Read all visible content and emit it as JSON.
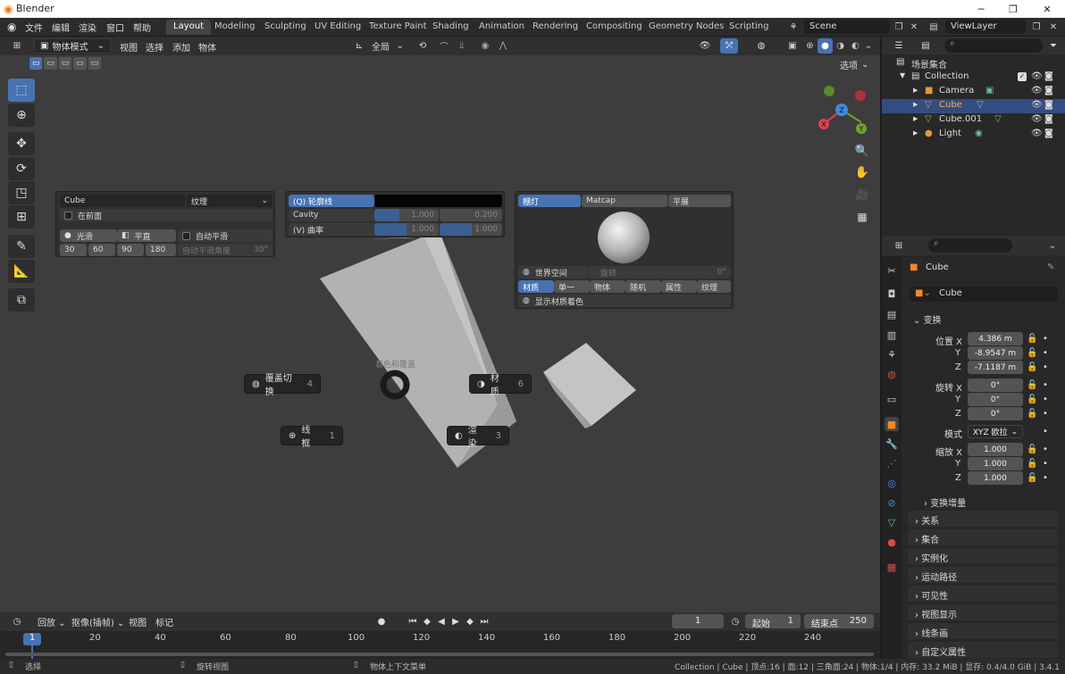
{
  "window": {
    "title": "Blender",
    "min_icon": "minimize-icon",
    "max_icon": "maximize-icon",
    "close_icon": "close-icon"
  },
  "menu": {
    "items": [
      "文件",
      "编辑",
      "渲染",
      "窗口",
      "帮助"
    ]
  },
  "workspaces": {
    "tabs": [
      "Layout",
      "Modeling",
      "Sculpting",
      "UV Editing",
      "Texture Paint",
      "Shading",
      "Animation",
      "Rendering",
      "Compositing",
      "Geometry Nodes",
      "Scripting"
    ],
    "active": "Layout"
  },
  "scene": {
    "label": "Scene",
    "view_layer": "ViewLayer"
  },
  "viewport": {
    "mode": "物体模式",
    "menus": [
      "视图",
      "选择",
      "添加",
      "物体"
    ],
    "transform_orientation": "全局",
    "options_label": "选项",
    "gizmo_axes": {
      "x": "X",
      "y": "Y",
      "z": "Z"
    }
  },
  "overlay_panel": {
    "object_name": "Cube",
    "texture_label": "纹理",
    "in_front": "在前面",
    "smooth": "光滑",
    "flat": "平直",
    "auto_smooth": "自动平滑",
    "angles": [
      "30",
      "60",
      "90",
      "180"
    ],
    "auto_smooth_angle_label": "自动平滑角度",
    "auto_smooth_angle_value": "30°"
  },
  "cavity_panel": {
    "outline_label": "(Q) 轮廓线",
    "cavity_label": "Cavity",
    "cavity_v1": "1.000",
    "cavity_v2": "0.200",
    "curvature_label": "(V) 曲率",
    "curv_v1": "1.000",
    "curv_v2": "1.000"
  },
  "lighting_panel": {
    "tabs": [
      "棚灯",
      "Matcap",
      "平展"
    ],
    "active_tab": "棚灯",
    "world_space": "世界空间",
    "rotation_label": "旋转",
    "rotation_value": "0°",
    "color_tabs": [
      "材质",
      "单一",
      "物体",
      "随机",
      "属性",
      "纹理"
    ],
    "active_color_tab": "材质",
    "show_material_color": "显示材质着色"
  },
  "pie_menu": {
    "title": "着色和覆盖",
    "items": [
      {
        "label": "覆盖切换",
        "key": "4"
      },
      {
        "label": "材质",
        "key": "6"
      },
      {
        "label": "线框",
        "key": "1"
      },
      {
        "label": "渲染",
        "key": "3"
      }
    ]
  },
  "outliner": {
    "root": "场景集合",
    "collection": "Collection",
    "items": [
      {
        "name": "Camera"
      },
      {
        "name": "Cube",
        "selected": true
      },
      {
        "name": "Cube.001"
      },
      {
        "name": "Light"
      }
    ]
  },
  "properties": {
    "object_name": "Cube",
    "data_name": "Cube",
    "transform_header": "变换",
    "location_label": "位置 X",
    "loc": [
      "4.386 m",
      "-8.9547 m",
      "-7.1187 m"
    ],
    "rotation_label": "旋转 X",
    "rot": [
      "0°",
      "0°",
      "0°"
    ],
    "mode_label": "模式",
    "mode_value": "XYZ 欧拉",
    "scale_label": "缩放 X",
    "scale": [
      "1.000",
      "1.000",
      "1.000"
    ],
    "axis_y": "Y",
    "axis_z": "Z",
    "delta": "变换增量",
    "sections": [
      "关系",
      "集合",
      "实例化",
      "运动路径",
      "可见性",
      "视图显示",
      "线条画",
      "自定义属性"
    ]
  },
  "timeline": {
    "menus": [
      "回放",
      "抠像(插帧)",
      "视图",
      "标记"
    ],
    "current_frame": "1",
    "start_label": "起始",
    "start": "1",
    "end_label": "结束点",
    "end": "250",
    "ticks": [
      "1",
      "20",
      "40",
      "60",
      "80",
      "100",
      "120",
      "140",
      "160",
      "180",
      "200",
      "220",
      "240"
    ]
  },
  "statusbar": {
    "select": "选择",
    "rotate_view": "旋转视图",
    "context_menu": "物体上下文菜单",
    "info": "Collection | Cube | 顶点:16 | 面:12 | 三角面:24 | 物体:1/4 | 内存: 33.2 MiB | 显存: 0.4/4.0 GiB | 3.4.1"
  },
  "colors": {
    "accent": "#4772b3",
    "viewport_bg": "#3d3d3d",
    "panel_bg": "#303030",
    "x_axis": "#e0414f",
    "y_axis": "#6ba52f",
    "z_axis": "#3d8bdc"
  }
}
